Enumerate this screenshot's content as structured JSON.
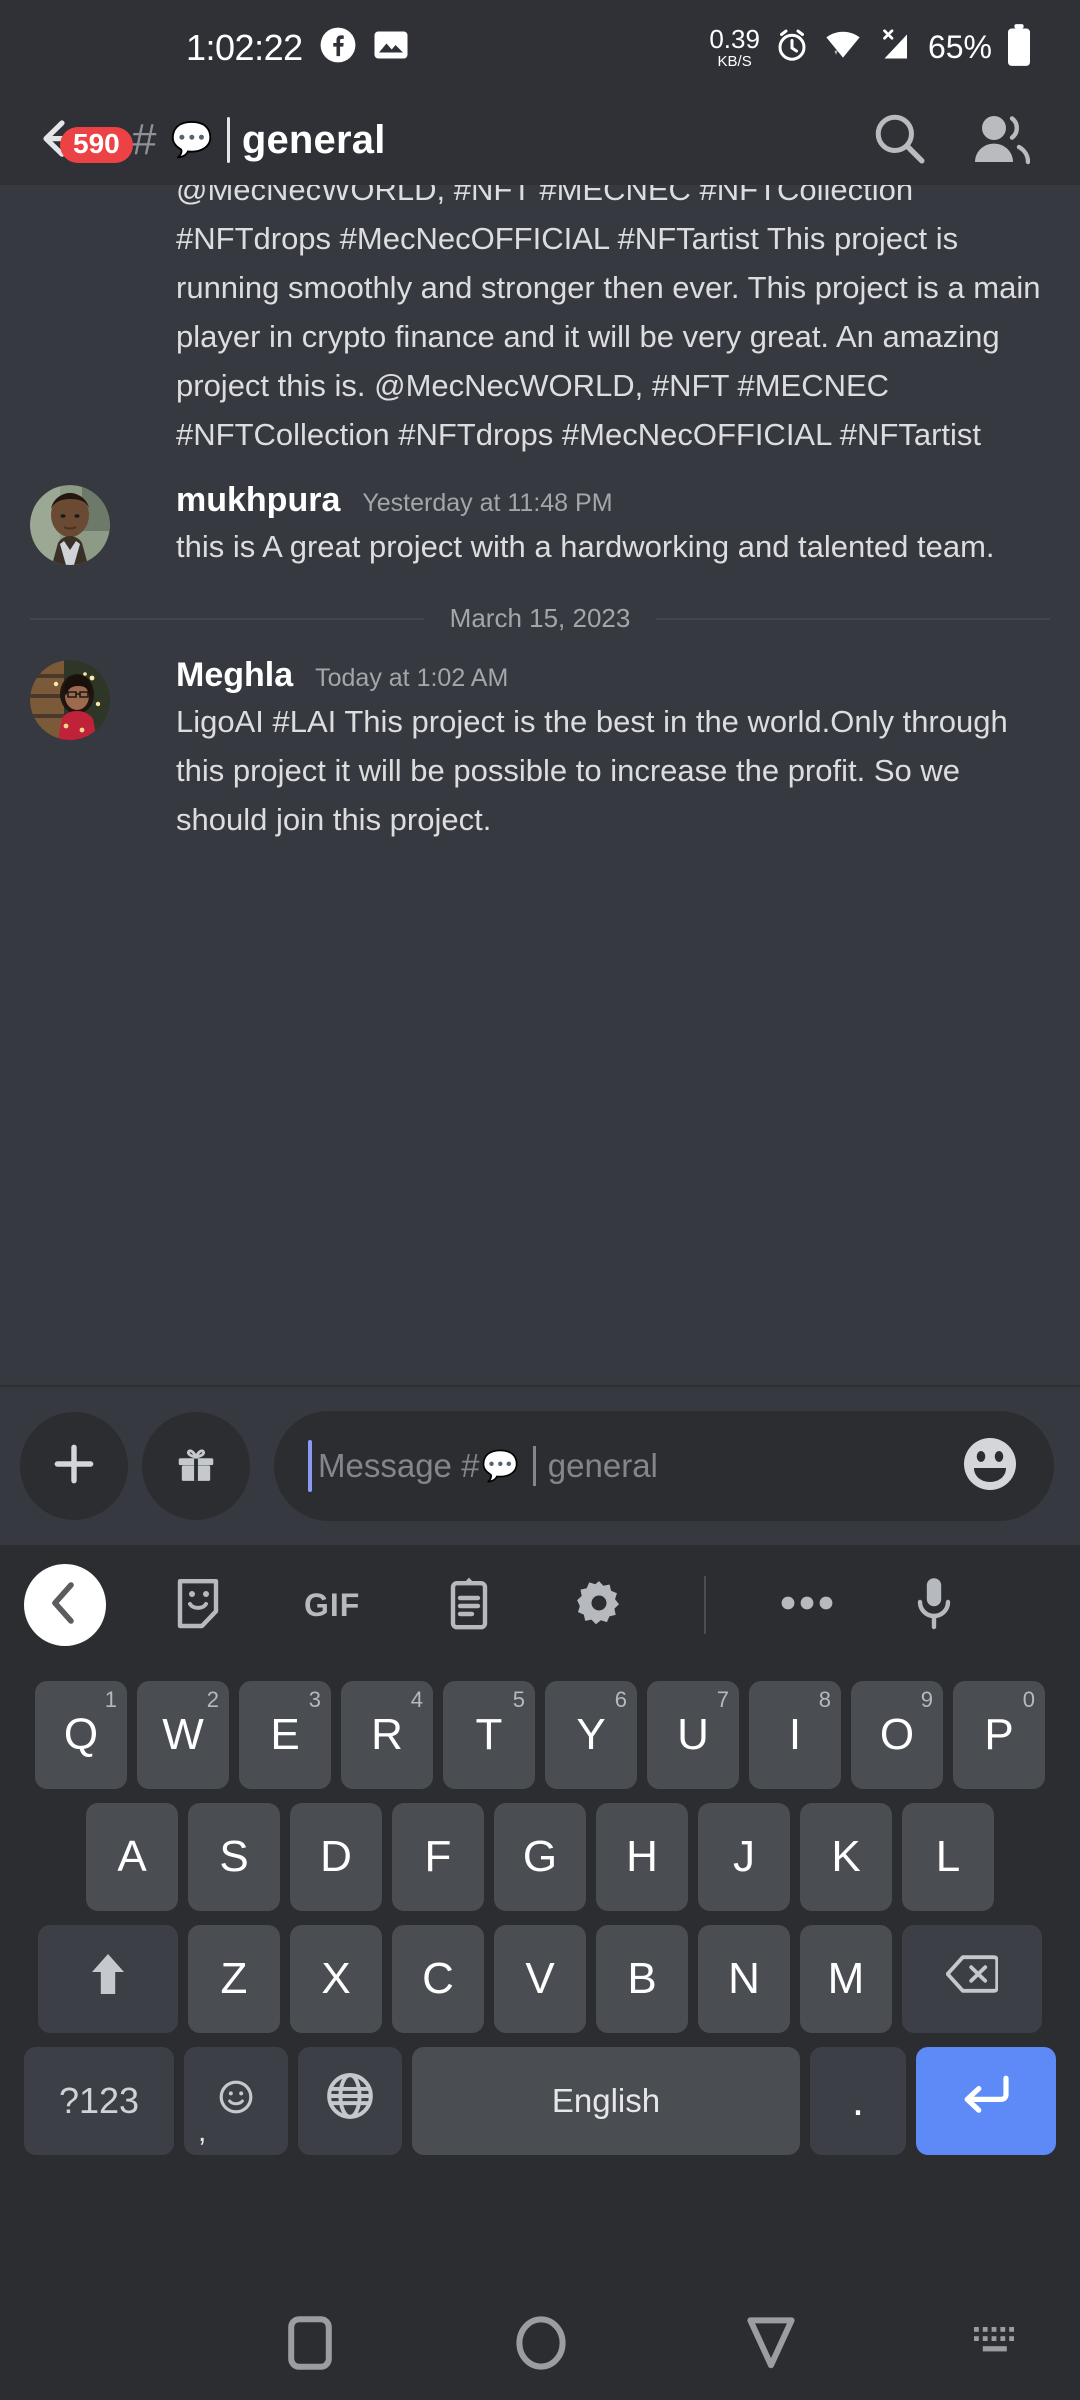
{
  "statusbar": {
    "time": "1:02:22",
    "facebook_icon": "facebook-icon",
    "gallery_icon": "image-icon",
    "net_speed_value": "0.39",
    "net_speed_unit": "KB/S",
    "alarm_icon": "alarm-icon",
    "wifi_icon": "wifi-icon",
    "signal_icon": "signal-x-icon",
    "battery_percent": "65%",
    "battery_icon": "battery-icon"
  },
  "header": {
    "back_icon": "back-arrow-icon",
    "unread_badge": "590",
    "hash": "#",
    "channel_emoji": "💬",
    "channel_name": "general",
    "search_icon": "search-icon",
    "members_icon": "members-icon"
  },
  "messages": {
    "continued_text": "@MecNecWORLD, #NFT #MECNEC #NFTCollection #NFTdrops #MecNecOFFICIAL #NFTartist\nThis project is running smoothly and stronger then ever. This project is a main player in crypto finance and it will be very great. An amazing project this is. @MecNecWORLD, #NFT #MECNEC #NFTCollection #NFTdrops #MecNecOFFICIAL #NFTartist",
    "items": [
      {
        "author": "mukhpura",
        "timestamp": "Yesterday at 11:48 PM",
        "text": "this is A great project with a hardworking and talented team."
      },
      {
        "author": "Meghla",
        "timestamp": "Today at 1:02 AM",
        "text": "LigoAI #LAI\nThis project is the best in the world.Only through this project it will be possible to increase the profit. So we should join this project."
      }
    ],
    "date_divider": "March 15, 2023"
  },
  "composer": {
    "add_icon": "plus-icon",
    "gift_icon": "gift-icon",
    "placeholder_prefix": "Message #",
    "placeholder_emoji": "💬",
    "placeholder_suffix": "general",
    "emoji_icon": "emoji-icon"
  },
  "keyboard_toolbar": {
    "back_icon": "chevron-left-icon",
    "sticker_icon": "sticker-icon",
    "gif_label": "GIF",
    "clipboard_icon": "clipboard-icon",
    "settings_icon": "gear-icon",
    "more_icon": "more-dots-icon",
    "mic_icon": "microphone-icon"
  },
  "keyboard": {
    "row1": [
      {
        "key": "Q",
        "sup": "1"
      },
      {
        "key": "W",
        "sup": "2"
      },
      {
        "key": "E",
        "sup": "3"
      },
      {
        "key": "R",
        "sup": "4"
      },
      {
        "key": "T",
        "sup": "5"
      },
      {
        "key": "Y",
        "sup": "6"
      },
      {
        "key": "U",
        "sup": "7"
      },
      {
        "key": "I",
        "sup": "8"
      },
      {
        "key": "O",
        "sup": "9"
      },
      {
        "key": "P",
        "sup": "0"
      }
    ],
    "row2": [
      "A",
      "S",
      "D",
      "F",
      "G",
      "H",
      "J",
      "K",
      "L"
    ],
    "row3": [
      "Z",
      "X",
      "C",
      "V",
      "B",
      "N",
      "M"
    ],
    "shift_icon": "shift-icon",
    "backspace_icon": "backspace-icon",
    "symbols_label": "?123",
    "comma_label": ",",
    "emoji_icon": "emoji-icon",
    "globe_icon": "globe-icon",
    "space_label": "English",
    "period_label": ".",
    "enter_icon": "enter-icon"
  },
  "navbar": {
    "recents_icon": "recents-square-icon",
    "home_icon": "home-circle-icon",
    "back_icon": "back-triangle-icon",
    "keyboard_icon": "keyboard-icon"
  },
  "colors": {
    "app_bg": "#36393f",
    "chrome_bg": "#2f3136",
    "keyboard_bg": "#2b2d31",
    "key_bg": "#4a4d52",
    "accent_blue": "#5d8af6",
    "badge_red": "#ed4245",
    "text_primary": "#dcddde",
    "text_muted": "#a3a6aa"
  }
}
